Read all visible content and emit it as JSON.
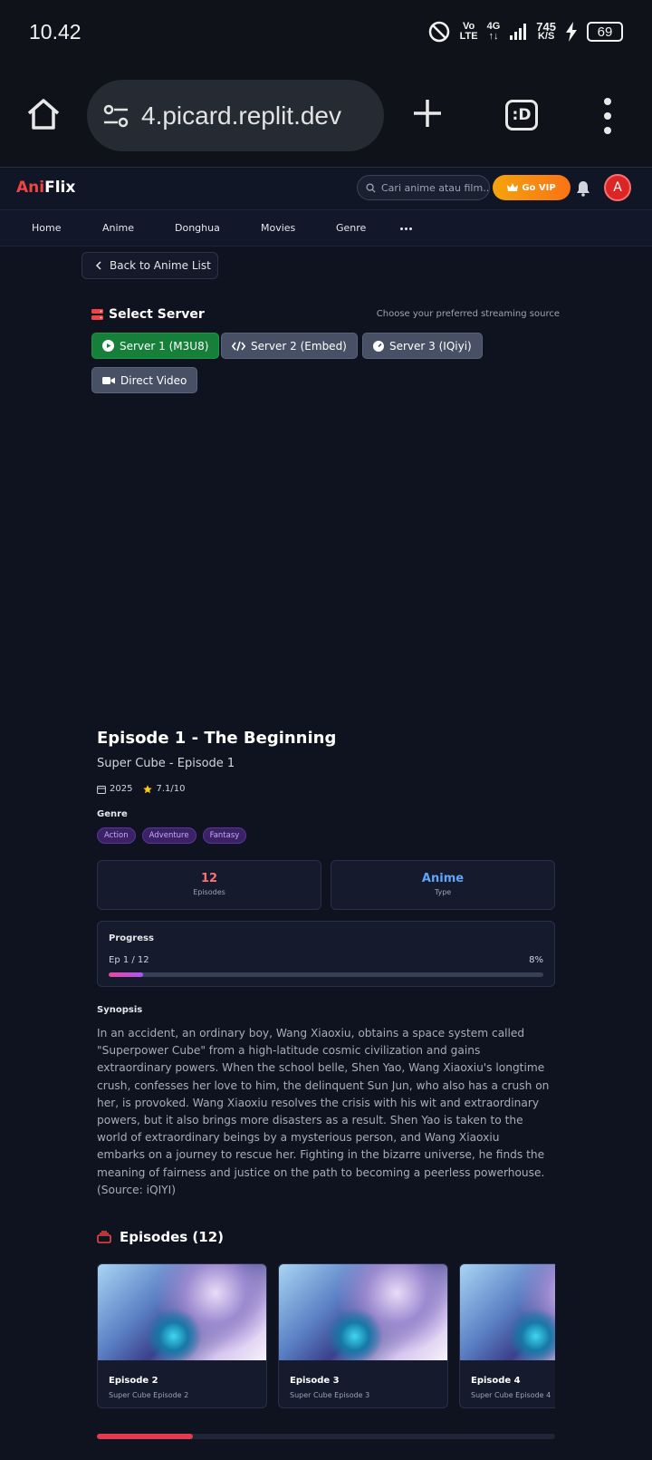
{
  "status": {
    "time": "10.42",
    "volte_top": "Vo",
    "volte_bottom": "LTE",
    "net_top": "4G",
    "speed_top": "745",
    "speed_bottom": "K/S",
    "battery": "69"
  },
  "browser": {
    "url": "4.picard.replit.dev",
    "tabs_label": ":D"
  },
  "header": {
    "logo_a": "Ani",
    "logo_b": "Flix",
    "search_placeholder": "Cari anime atau film...",
    "vip_label": "Go VIP",
    "avatar_letter": "A"
  },
  "nav": {
    "items": [
      "Home",
      "Anime",
      "Donghua",
      "Movies",
      "Genre"
    ]
  },
  "back_label": "Back to Anime List",
  "server": {
    "title": "Select Server",
    "hint": "Choose your preferred streaming source",
    "options": [
      "Server 1 (M3U8)",
      "Server 2 (Embed)",
      "Server 3 (IQiyi)",
      "Direct Video"
    ]
  },
  "episode": {
    "title": "Episode 1 - The Beginning",
    "subtitle": "Super Cube - Episode 1",
    "year": "2025",
    "rating": "7.1/10",
    "genre_label": "Genre",
    "genres": [
      "Action",
      "Adventure",
      "Fantasy"
    ],
    "stats": [
      {
        "value": "12",
        "label": "Episodes",
        "color": "#f87171"
      },
      {
        "value": "Anime",
        "label": "Type",
        "color": "#60a5fa"
      }
    ],
    "progress": {
      "title": "Progress",
      "left": "Ep 1 / 12",
      "right": "8%",
      "fraction": 0.08
    },
    "synopsis_label": "Synopsis",
    "synopsis": "In an accident, an ordinary boy, Wang Xiaoxiu, obtains a space system called \"Superpower Cube\" from a high-latitude cosmic civilization and gains extraordinary powers. When the school belle, Shen Yao, Wang Xiaoxiu's longtime crush, confesses her love to him, the delinquent Sun Jun, who also has a crush on her, is provoked. Wang Xiaoxiu resolves the crisis with his wit and extraordinary powers, but it also brings more disasters as a result. Shen Yao is taken to the world of extraordinary beings by a mysterious person, and Wang Xiaoxiu embarks on a journey to rescue her. Fighting in the bizarre universe, he finds the meaning of fairness and justice on the path to becoming a peerless powerhouse. (Source: iQIYI)"
  },
  "episodes": {
    "title": "Episodes (12)",
    "cards": [
      {
        "name": "Episode 2",
        "desc": "Super Cube Episode 2"
      },
      {
        "name": "Episode 3",
        "desc": "Super Cube Episode 3"
      },
      {
        "name": "Episode 4",
        "desc": "Super Cube Episode 4"
      }
    ]
  }
}
